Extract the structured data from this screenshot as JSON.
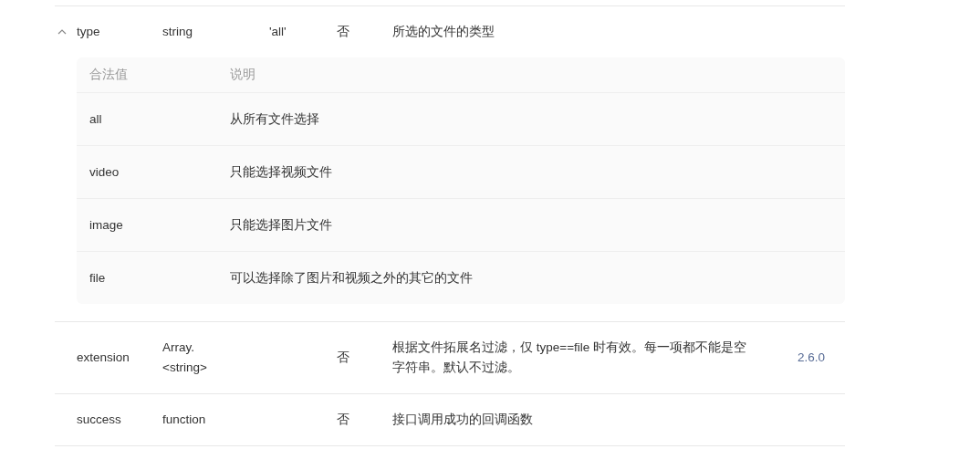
{
  "params": [
    {
      "name": "type",
      "type": "string",
      "default": "'all'",
      "required": "否",
      "description": "所选的文件的类型",
      "expanded": true,
      "values_table": {
        "columns": [
          "合法值",
          "说明"
        ],
        "rows": [
          {
            "value": "all",
            "description": "从所有文件选择"
          },
          {
            "value": "video",
            "description": "只能选择视频文件"
          },
          {
            "value": "image",
            "description": "只能选择图片文件"
          },
          {
            "value": "file",
            "description": "可以选择除了图片和视频之外的其它的文件"
          }
        ]
      }
    },
    {
      "name": "extension",
      "type": "Array.<string>",
      "required": "否",
      "description": "根据文件拓展名过滤，仅 type==file 时有效。每一项都不能是空字符串。默认不过滤。",
      "version": "2.6.0"
    },
    {
      "name": "success",
      "type": "function",
      "required": "否",
      "description": "接口调用成功的回调函数"
    }
  ]
}
